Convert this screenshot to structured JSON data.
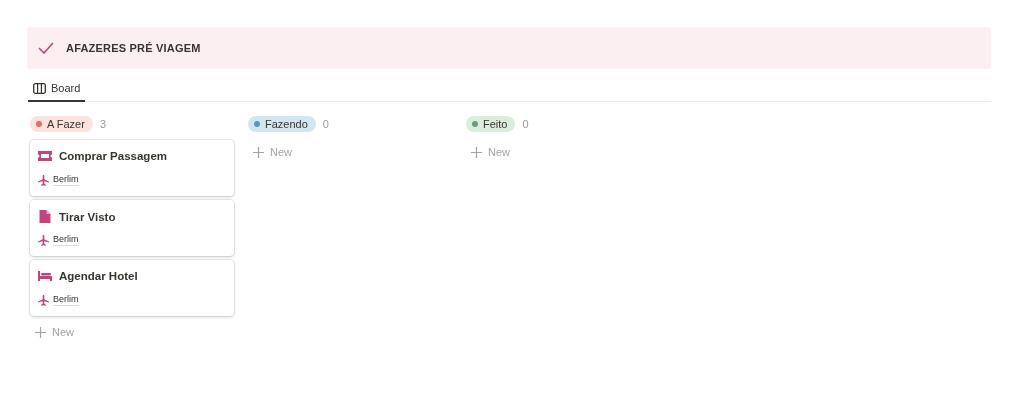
{
  "header": {
    "title": "AFAZERES PRÉ VIAGEM"
  },
  "tabs": [
    {
      "label": "Board",
      "selected": true
    }
  ],
  "columns": [
    {
      "status": "A Fazer",
      "color": "#e16f64",
      "count": "3",
      "cards": [
        {
          "kind": "ticket",
          "title": "Comprar Passagem",
          "tag": "Berlim"
        },
        {
          "kind": "document",
          "title": "Tirar Visto",
          "tag": "Berlim"
        },
        {
          "kind": "bed",
          "title": "Agendar Hotel",
          "tag": "Berlim"
        }
      ],
      "new_label": "New"
    },
    {
      "status": "Fazendo",
      "color": "#5b97bd",
      "count": "0",
      "new_label": "New"
    },
    {
      "status": "Feito",
      "color": "#6c9b7d",
      "count": "0",
      "new_label": "New"
    }
  ]
}
